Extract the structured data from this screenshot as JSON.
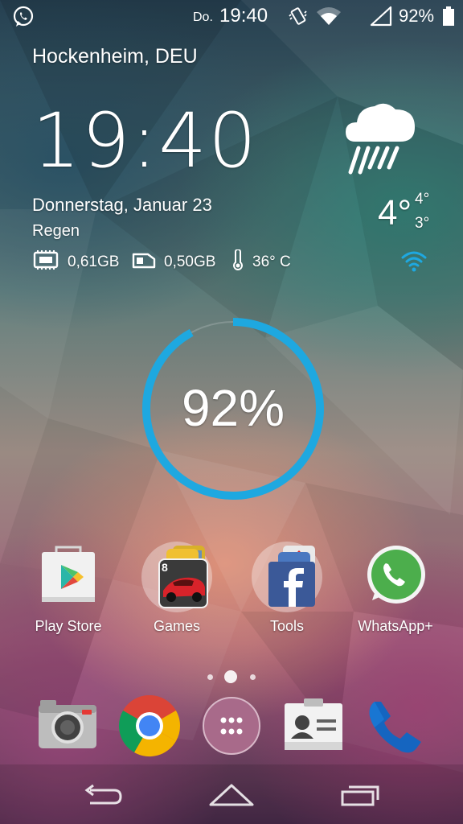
{
  "status_bar": {
    "notification_icon": "whatsapp-icon",
    "day": "Do.",
    "time": "19:40",
    "icons": [
      "vibrate-icon",
      "wifi-icon",
      "signal-icon",
      "battery-icon"
    ],
    "battery_percent": "92%"
  },
  "widget": {
    "location": "Hockenheim, DEU",
    "clock": "19:40",
    "date": "Donnerstag, Januar 23",
    "condition": "Regen",
    "ram": "0,61GB",
    "storage": "0,50GB",
    "battery_temp": "36° C",
    "weather_icon": "rain-cloud-icon",
    "temp_current": "4°",
    "temp_high": "4°",
    "temp_low": "3°"
  },
  "battery_circle": {
    "label": "92%",
    "level": 0.92,
    "color": "#1ea8e0"
  },
  "apps": [
    {
      "label": "Play Store",
      "icon": "play-store-icon"
    },
    {
      "label": "Games",
      "icon": "games-folder-icon"
    },
    {
      "label": "Tools",
      "icon": "tools-folder-icon"
    },
    {
      "label": "WhatsApp+",
      "icon": "whatsapp-plus-icon"
    }
  ],
  "page_indicator": {
    "pages": 3,
    "current": 2
  },
  "dock": [
    "camera-icon",
    "chrome-icon",
    "app-drawer-icon",
    "contacts-icon",
    "phone-icon"
  ],
  "nav_bar": [
    "back-icon",
    "home-icon",
    "recents-icon"
  ],
  "colors": {
    "accent_blue": "#1ea8e0",
    "whatsapp_green": "#4cae4c",
    "facebook_blue": "#3b5998",
    "phone_blue": "#1976d2"
  }
}
